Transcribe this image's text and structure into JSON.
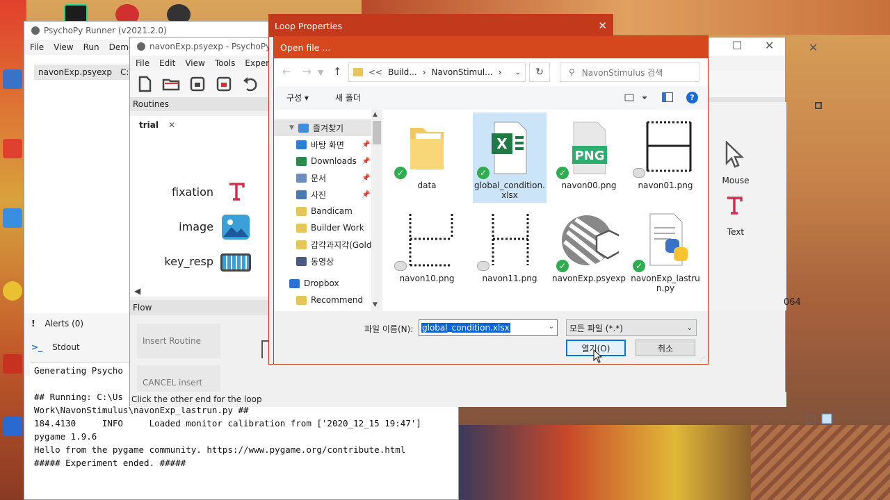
{
  "runner": {
    "title": "PsychoPy Runner (v2021.2.0)",
    "menu": [
      "File",
      "View",
      "Run",
      "Demos"
    ],
    "list_item": "navonExp.psyexp",
    "list_path": "C:\\U",
    "alerts_label": "Alerts (0)",
    "stdout_label": "Stdout",
    "stdout_lines": [
      "Generating Psycho",
      "",
      "## Running: C:\\Us",
      "Work\\NavonStimulus\\navonExp_lastrun.py ##",
      "184.4130     INFO     Loaded monitor calibration from ['2020_12_15 19:47']",
      "pygame 1.9.6",
      "Hello from the pygame community. https://www.pygame.org/contribute.html",
      "##### Experiment ended. #####"
    ]
  },
  "builder": {
    "title": "navonExp.psyexp - PsychoPy Bu",
    "menu": [
      "File",
      "Edit",
      "View",
      "Tools",
      "Experim"
    ],
    "routines_label": "Routines",
    "tab_label": "trial",
    "components": [
      "fixation",
      "image",
      "key_resp"
    ],
    "flow_label": "Flow",
    "insert_routine": "Insert Routine",
    "cancel_insert": "CANCEL insert",
    "status": "Click the other end for the loop",
    "right_components": [
      "Mouse",
      "Text"
    ],
    "side_number": "064"
  },
  "loop_dialog": {
    "title": "Loop Properties"
  },
  "open_dialog": {
    "title": "Open file ...",
    "address": [
      "<<",
      "Build...",
      "NavonStimul...",
      ""
    ],
    "search_placeholder": "NavonStimulus 검색",
    "cmd_organize": "구성 ▾",
    "cmd_new_folder": "새 폴더",
    "nav_items": [
      {
        "label": "즐겨찾기",
        "color": "#3d8ee0"
      },
      {
        "label": "바탕 화면",
        "color": "#2f7fd0"
      },
      {
        "label": "Downloads",
        "color": "#2a8a4a"
      },
      {
        "label": "문서",
        "color": "#6b8fbf"
      },
      {
        "label": "사진",
        "color": "#4a7ab0"
      },
      {
        "label": "Bandicam",
        "color": "#e8c55a"
      },
      {
        "label": "Builder Work",
        "color": "#e8c55a"
      },
      {
        "label": "감각과지각(Gold",
        "color": "#e8c55a"
      },
      {
        "label": "동영상",
        "color": "#4a5a80"
      },
      {
        "label": "Dropbox",
        "color": "#2a72d8"
      },
      {
        "label": "Recommend",
        "color": "#e8c55a"
      }
    ],
    "files": [
      {
        "name": "data",
        "kind": "folder",
        "status": "check"
      },
      {
        "name": "global_condition.xlsx",
        "kind": "excel",
        "status": "check",
        "selected": true
      },
      {
        "name": "navon00.png",
        "kind": "png",
        "status": "check"
      },
      {
        "name": "navon01.png",
        "kind": "navon",
        "status": "cloud"
      },
      {
        "name": "navon10.png",
        "kind": "navon",
        "status": "cloud"
      },
      {
        "name": "navon11.png",
        "kind": "navon",
        "status": "cloud"
      },
      {
        "name": "navonExp.psyexp",
        "kind": "psyexp",
        "status": "check"
      },
      {
        "name": "navonExp_lastrun.py",
        "kind": "python",
        "status": "check"
      }
    ],
    "filename_label": "파일 이름(N):",
    "filename_value": "global_condition.xlsx",
    "filetype_value": "모든 파일 (*.*)",
    "open_button": "열기(O)",
    "cancel_button": "취소",
    "png_text": "PNG",
    "excel_text": "X"
  },
  "colors": {
    "accent": "#d6471e",
    "title_red": "#c23a1b",
    "select_blue": "#0a64d6",
    "check_green": "#2eae4e"
  }
}
